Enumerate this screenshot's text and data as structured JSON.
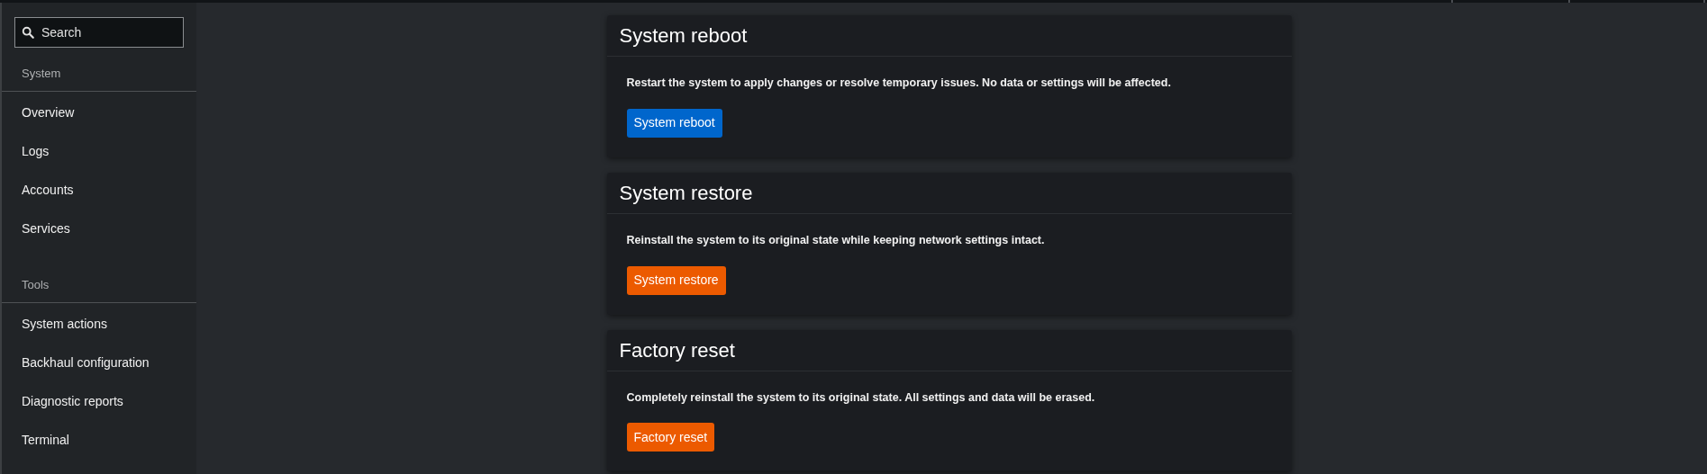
{
  "sidebar": {
    "search": {
      "placeholder": "Search"
    },
    "sections": [
      {
        "title": "System",
        "items": [
          {
            "label": "Overview"
          },
          {
            "label": "Logs"
          },
          {
            "label": "Accounts"
          },
          {
            "label": "Services"
          }
        ]
      },
      {
        "title": "Tools",
        "items": [
          {
            "label": "System actions"
          },
          {
            "label": "Backhaul configuration"
          },
          {
            "label": "Diagnostic reports"
          },
          {
            "label": "Terminal"
          }
        ]
      }
    ]
  },
  "cards": [
    {
      "title": "System reboot",
      "description": "Restart the system to apply changes or resolve temporary issues. No data or settings will be affected.",
      "button": {
        "label": "System reboot",
        "kind": "primary"
      }
    },
    {
      "title": "System restore",
      "description": "Reinstall the system to its original state while keeping network settings intact.",
      "button": {
        "label": "System restore",
        "kind": "danger"
      }
    },
    {
      "title": "Factory reset",
      "description": "Completely reinstall the system to its original state. All settings and data will be erased.",
      "button": {
        "label": "Factory reset",
        "kind": "danger"
      }
    }
  ]
}
